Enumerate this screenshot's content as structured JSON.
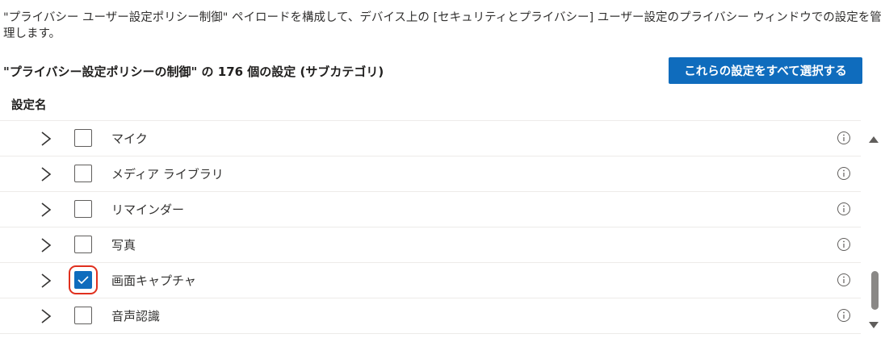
{
  "description": "\"プライバシー ユーザー設定ポリシー制御\" ペイロードを構成して、デバイス上の [セキュリティとプライバシー] ユーザー設定のプライバシー ウィンドウでの設定を管理します。",
  "subcategory_title": "\"プライバシー設定ポリシーの制御\" の 176 個の設定 (サブカテゴリ)",
  "select_all_label": "これらの設定をすべて選択する",
  "column_header": "設定名",
  "rows": [
    {
      "label": "マイク",
      "checked": false
    },
    {
      "label": "メディア ライブラリ",
      "checked": false
    },
    {
      "label": "リマインダー",
      "checked": false
    },
    {
      "label": "写真",
      "checked": false
    },
    {
      "label": "画面キャプチャ",
      "checked": true
    },
    {
      "label": "音声認識",
      "checked": false
    }
  ],
  "icons": {
    "expand": "chevron-right-icon",
    "info": "info-icon",
    "checkmark": "checkmark-icon",
    "scroll_up": "triangle-up-icon",
    "scroll_down": "triangle-down-icon"
  },
  "colors": {
    "accent": "#0f6cbd",
    "highlight_outline": "#e0301e",
    "divider": "#edebe9",
    "scroll_thumb": "#8a8886"
  }
}
